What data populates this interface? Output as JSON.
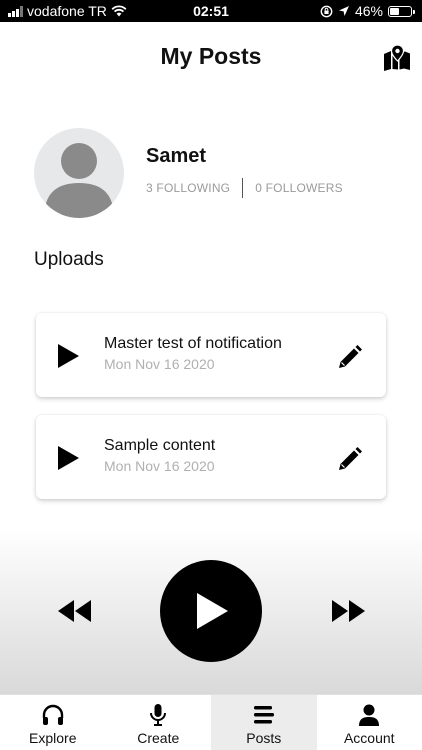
{
  "status_bar": {
    "carrier": "vodafone TR",
    "time": "02:51",
    "battery": "46%",
    "battery_level": 0.46
  },
  "header": {
    "title": "My Posts",
    "map_icon": "map-marker-icon"
  },
  "profile": {
    "name": "Samet",
    "following": "3 FOLLOWING",
    "followers": "0 FOLLOWERS"
  },
  "uploads": {
    "heading": "Uploads",
    "items": [
      {
        "title": "Master test of notification",
        "date": "Mon Nov 16 2020"
      },
      {
        "title": "Sample content",
        "date": "Mon Nov 16 2020"
      }
    ]
  },
  "tabs": [
    {
      "label": "Explore",
      "icon": "headphones-icon"
    },
    {
      "label": "Create",
      "icon": "microphone-icon"
    },
    {
      "label": "Posts",
      "icon": "list-icon",
      "active": true
    },
    {
      "label": "Account",
      "icon": "user-icon"
    }
  ],
  "colors": {
    "accent": "#000000",
    "muted_text": "#9a9a9a",
    "date_text": "#b0b0b0",
    "active_tab_bg": "#ececec"
  }
}
